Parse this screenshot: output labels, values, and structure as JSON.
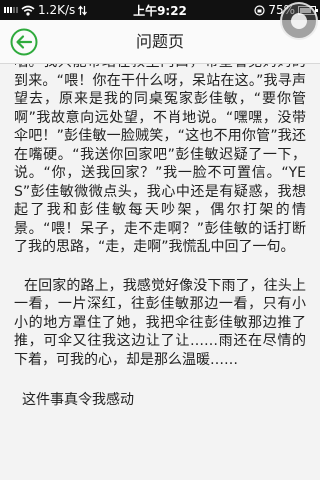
{
  "status_bar": {
    "carrier_speed": "1.2K/s",
    "time": "上午9:22",
    "battery": "75%",
    "battery_level": 0.75
  },
  "nav": {
    "title": "问题页",
    "back_icon": "back-arrow-circle-icon",
    "accent_color": "#2eaa3c"
  },
  "content": {
    "paragraphs": [
      "咽。我只能带站在教室门口，希望看见妈妈的到来。“喂！你在干什么呀，呆站在这。”我寻声望去，原来是我的同桌冤家彭佳敏，“要你管啊”我故意向远处望，不肖地说。“嘿嘿，没带伞吧！”彭佳敏一脸贼笑，“这也不用你管”我还在嘴硬。“我送你回家吧”彭佳敏迟疑了一下，说。“你，送我回家？”我一脸不可置信。“YES”彭佳敏微微点头，我心中还是有疑惑，我想起了我和彭佳敏每天吵架，偶尔打架的情景。“喂！呆子，走不走啊？”彭佳敏的话打断了我的思路，“走，走啊”我慌乱中回了一句。",
      "在回家的路上，我感觉好像没下雨了，往头上一看，一片深红，往彭佳敏那边一看，只有小小的地方罩住了她，我把伞往彭佳敏那边推了推，可伞又往我这边让了让……雨还在尽情的下着，可我的心，却是那么温暖……",
      "这件事真令我感动"
    ]
  }
}
